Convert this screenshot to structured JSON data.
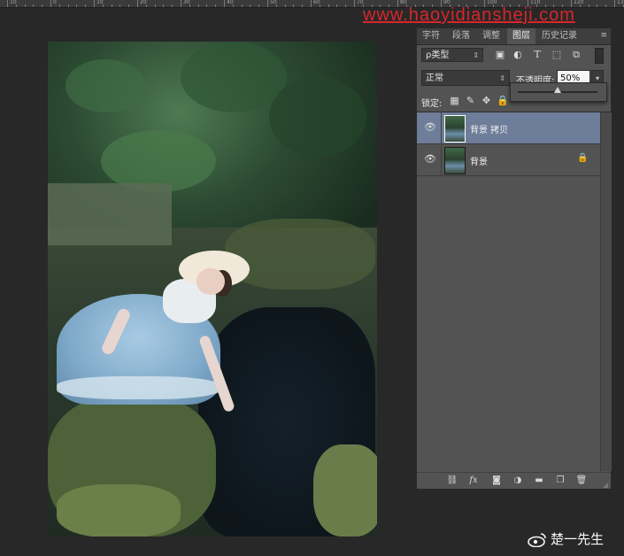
{
  "watermark": "www.haoyidiansheji.com",
  "ruler": {
    "labels": [
      "10",
      "0",
      "10",
      "20",
      "30",
      "40",
      "50",
      "60",
      "70",
      "80",
      "90",
      "100",
      "110",
      "120",
      "130",
      "140",
      "150",
      "160"
    ]
  },
  "panel": {
    "tabs": [
      "字符",
      "段落",
      "调整",
      "图层",
      "历史记录"
    ],
    "active_tab": "图层",
    "menu_icon": "≡",
    "filter": {
      "kind_label": "ρ类型",
      "icons": [
        "image-filter-icon",
        "adjustment-filter-icon",
        "type-filter-icon",
        "shape-filter-icon",
        "smart-object-filter-icon"
      ]
    },
    "blend_mode": "正常",
    "opacity_label": "不透明度:",
    "opacity_value": "50%",
    "opacity_fraction": 0.5,
    "lock_label": "锁定:",
    "layers": [
      {
        "name": "背景 拷贝",
        "selected": true,
        "locked": false
      },
      {
        "name": "背景",
        "selected": false,
        "locked": true
      }
    ],
    "bottom_icons": [
      "link-layers-icon",
      "fx-icon",
      "mask-icon",
      "adjustment-layer-icon",
      "group-icon",
      "new-layer-icon",
      "trash-icon"
    ],
    "fx_label": "fx"
  },
  "credit": {
    "text": "楚一先生"
  }
}
